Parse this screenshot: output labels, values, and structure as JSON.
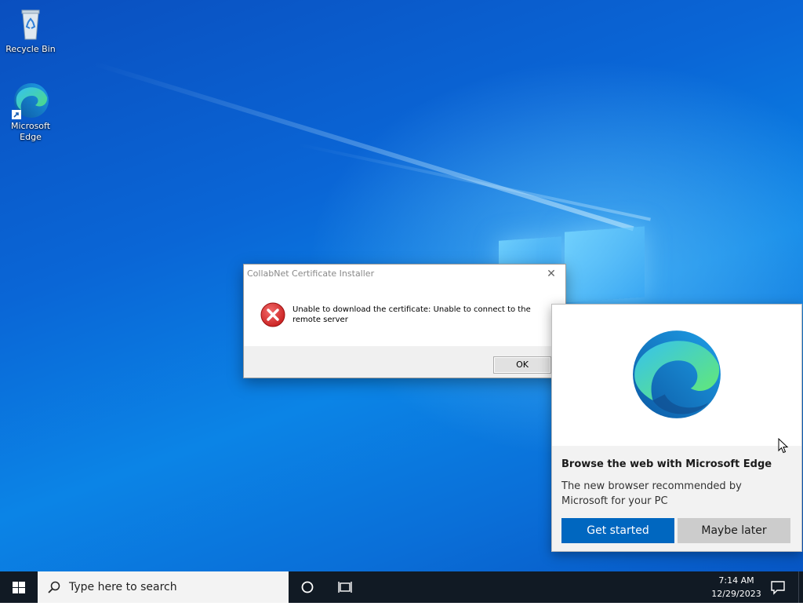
{
  "desktop": {
    "icons": [
      {
        "label": "Recycle Bin",
        "icon": "recycle-bin-icon"
      },
      {
        "label": "Microsoft Edge",
        "icon": "edge-icon"
      }
    ]
  },
  "dialog": {
    "title": "CollabNet Certificate Installer",
    "close_glyph": "✕",
    "message": "Unable to download the certificate: Unable to connect to the remote server",
    "ok_label": "OK",
    "icon": "error-icon"
  },
  "edge_popup": {
    "heading": "Browse the web with Microsoft Edge",
    "description": "The new browser recommended by Microsoft for your PC",
    "primary_label": "Get started",
    "secondary_label": "Maybe later",
    "colors": {
      "primary": "#0067c0",
      "secondary": "#cccccc"
    }
  },
  "taskbar": {
    "search_placeholder": "Type here to search",
    "time": "7:14 AM",
    "date": "12/29/2023"
  }
}
